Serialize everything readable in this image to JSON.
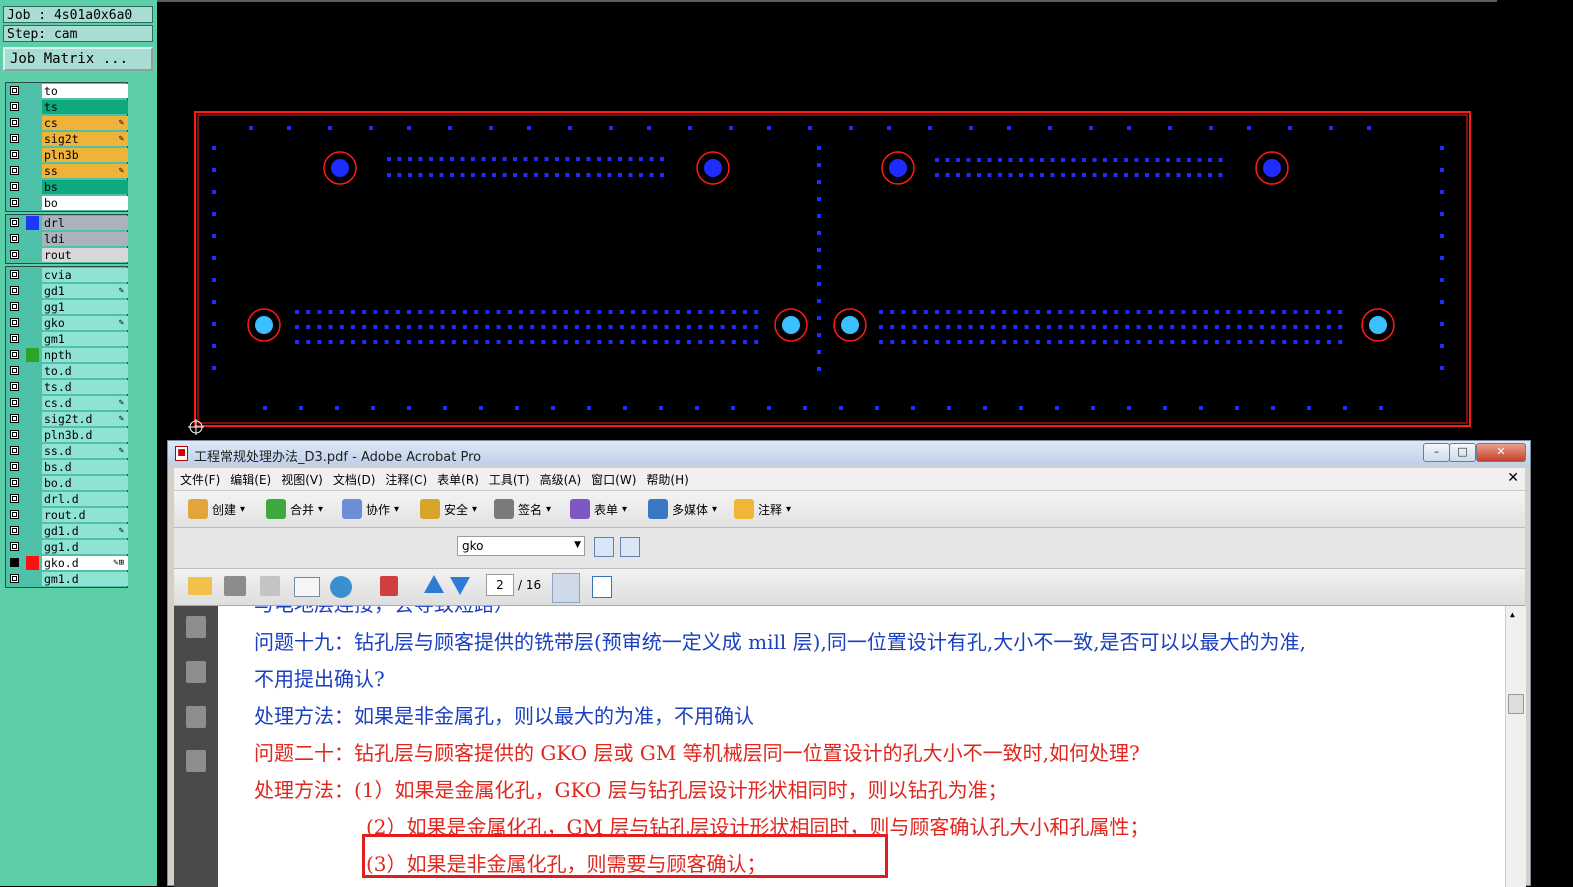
{
  "left_panel": {
    "job_line": "Job : 4s01a0x6a0",
    "step_line": "Step: cam",
    "job_matrix_button": "Job Matrix ...",
    "groups": [
      {
        "layers": [
          {
            "name": "to",
            "color": "#ffffff",
            "fx": ""
          },
          {
            "name": "ts",
            "color": "#0fa97f",
            "fx": ""
          },
          {
            "name": "cs",
            "color": "#f0b33a",
            "fx": "✎"
          },
          {
            "name": "sig2t",
            "color": "#f0b33a",
            "fx": "✎"
          },
          {
            "name": "pln3b",
            "color": "#f0b33a",
            "fx": ""
          },
          {
            "name": "ss",
            "color": "#f0b33a",
            "fx": "✎"
          },
          {
            "name": "bs",
            "color": "#0fa97f",
            "fx": ""
          },
          {
            "name": "bo",
            "color": "#ffffff",
            "fx": ""
          }
        ]
      },
      {
        "layers": [
          {
            "name": "drl",
            "color": "#aab3bd",
            "fx": ""
          },
          {
            "name": "ldi",
            "color": "#aab3bd",
            "fx": ""
          },
          {
            "name": "rout",
            "color": "#d8d8d8",
            "fx": ""
          }
        ]
      },
      {
        "layers": [
          {
            "name": "cvia",
            "color": "#8ee3d4",
            "fx": ""
          },
          {
            "name": "gd1",
            "color": "#8ee3d4",
            "fx": "✎"
          },
          {
            "name": "gg1",
            "color": "#8ee3d4",
            "fx": ""
          },
          {
            "name": "gko",
            "color": "#8ee3d4",
            "fx": "✎"
          },
          {
            "name": "gm1",
            "color": "#8ee3d4",
            "fx": ""
          },
          {
            "name": "npth",
            "color": "#8ee3d4",
            "fx": ""
          },
          {
            "name": "to.d",
            "color": "#8ee3d4",
            "fx": ""
          },
          {
            "name": "ts.d",
            "color": "#8ee3d4",
            "fx": ""
          },
          {
            "name": "cs.d",
            "color": "#8ee3d4",
            "fx": "✎"
          },
          {
            "name": "sig2t.d",
            "color": "#8ee3d4",
            "fx": "✎"
          },
          {
            "name": "pln3b.d",
            "color": "#8ee3d4",
            "fx": ""
          },
          {
            "name": "ss.d",
            "color": "#8ee3d4",
            "fx": "✎"
          },
          {
            "name": "bs.d",
            "color": "#8ee3d4",
            "fx": ""
          },
          {
            "name": "bo.d",
            "color": "#8ee3d4",
            "fx": ""
          },
          {
            "name": "drl.d",
            "color": "#8ee3d4",
            "fx": ""
          },
          {
            "name": "rout.d",
            "color": "#8ee3d4",
            "fx": ""
          },
          {
            "name": "gd1.d",
            "color": "#8ee3d4",
            "fx": "✎"
          },
          {
            "name": "gg1.d",
            "color": "#8ee3d4",
            "fx": ""
          },
          {
            "name": "gko.d",
            "color": "#ffffff",
            "fx": "✎⊞"
          },
          {
            "name": "gm1.d",
            "color": "#8ee3d4",
            "fx": ""
          }
        ]
      }
    ]
  },
  "acrobat": {
    "title": "工程常规处理办法_D3.pdf - Adobe Acrobat Pro",
    "menu": [
      "文件(F)",
      "编辑(E)",
      "视图(V)",
      "文档(D)",
      "注释(C)",
      "表单(R)",
      "工具(T)",
      "高级(A)",
      "窗口(W)",
      "帮助(H)"
    ],
    "toolbar": [
      "创建",
      "合并",
      "协作",
      "安全",
      "签名",
      "表单",
      "多媒体",
      "注释"
    ],
    "layer_select": "gko",
    "page_current": "2",
    "page_total": "/ 16",
    "doc_lines": [
      {
        "text": "与电地层连接，会导致短路）",
        "color": "blue"
      },
      {
        "text": "问题十九：钻孔层与顾客提供的铣带层(预审统一定义成 mill 层),同一位置设计有孔,大小不一致,是否可以以最大的为准,",
        "color": "blue"
      },
      {
        "text": "不用提出确认?",
        "color": "blue"
      },
      {
        "text": "处理方法：如果是非金属孔，则以最大的为准，不用确认",
        "color": "blue"
      },
      {
        "text": "问题二十：钻孔层与顾客提供的 GKO 层或 GM 等机械层同一位置设计的孔大小不一致时,如何处理?",
        "color": "red"
      },
      {
        "text": "处理方法：(1）如果是金属化孔，GKO 层与钻孔层设计形状相同时，则以钻孔为准；",
        "color": "red"
      },
      {
        "text": "(2）如果是金属化孔，GM 层与钻孔层设计形状相同时，则与顾客确认孔大小和孔属性；",
        "color": "red"
      },
      {
        "text": "(3）如果是非金属化孔，则需要与顾客确认；",
        "color": "red"
      }
    ]
  }
}
